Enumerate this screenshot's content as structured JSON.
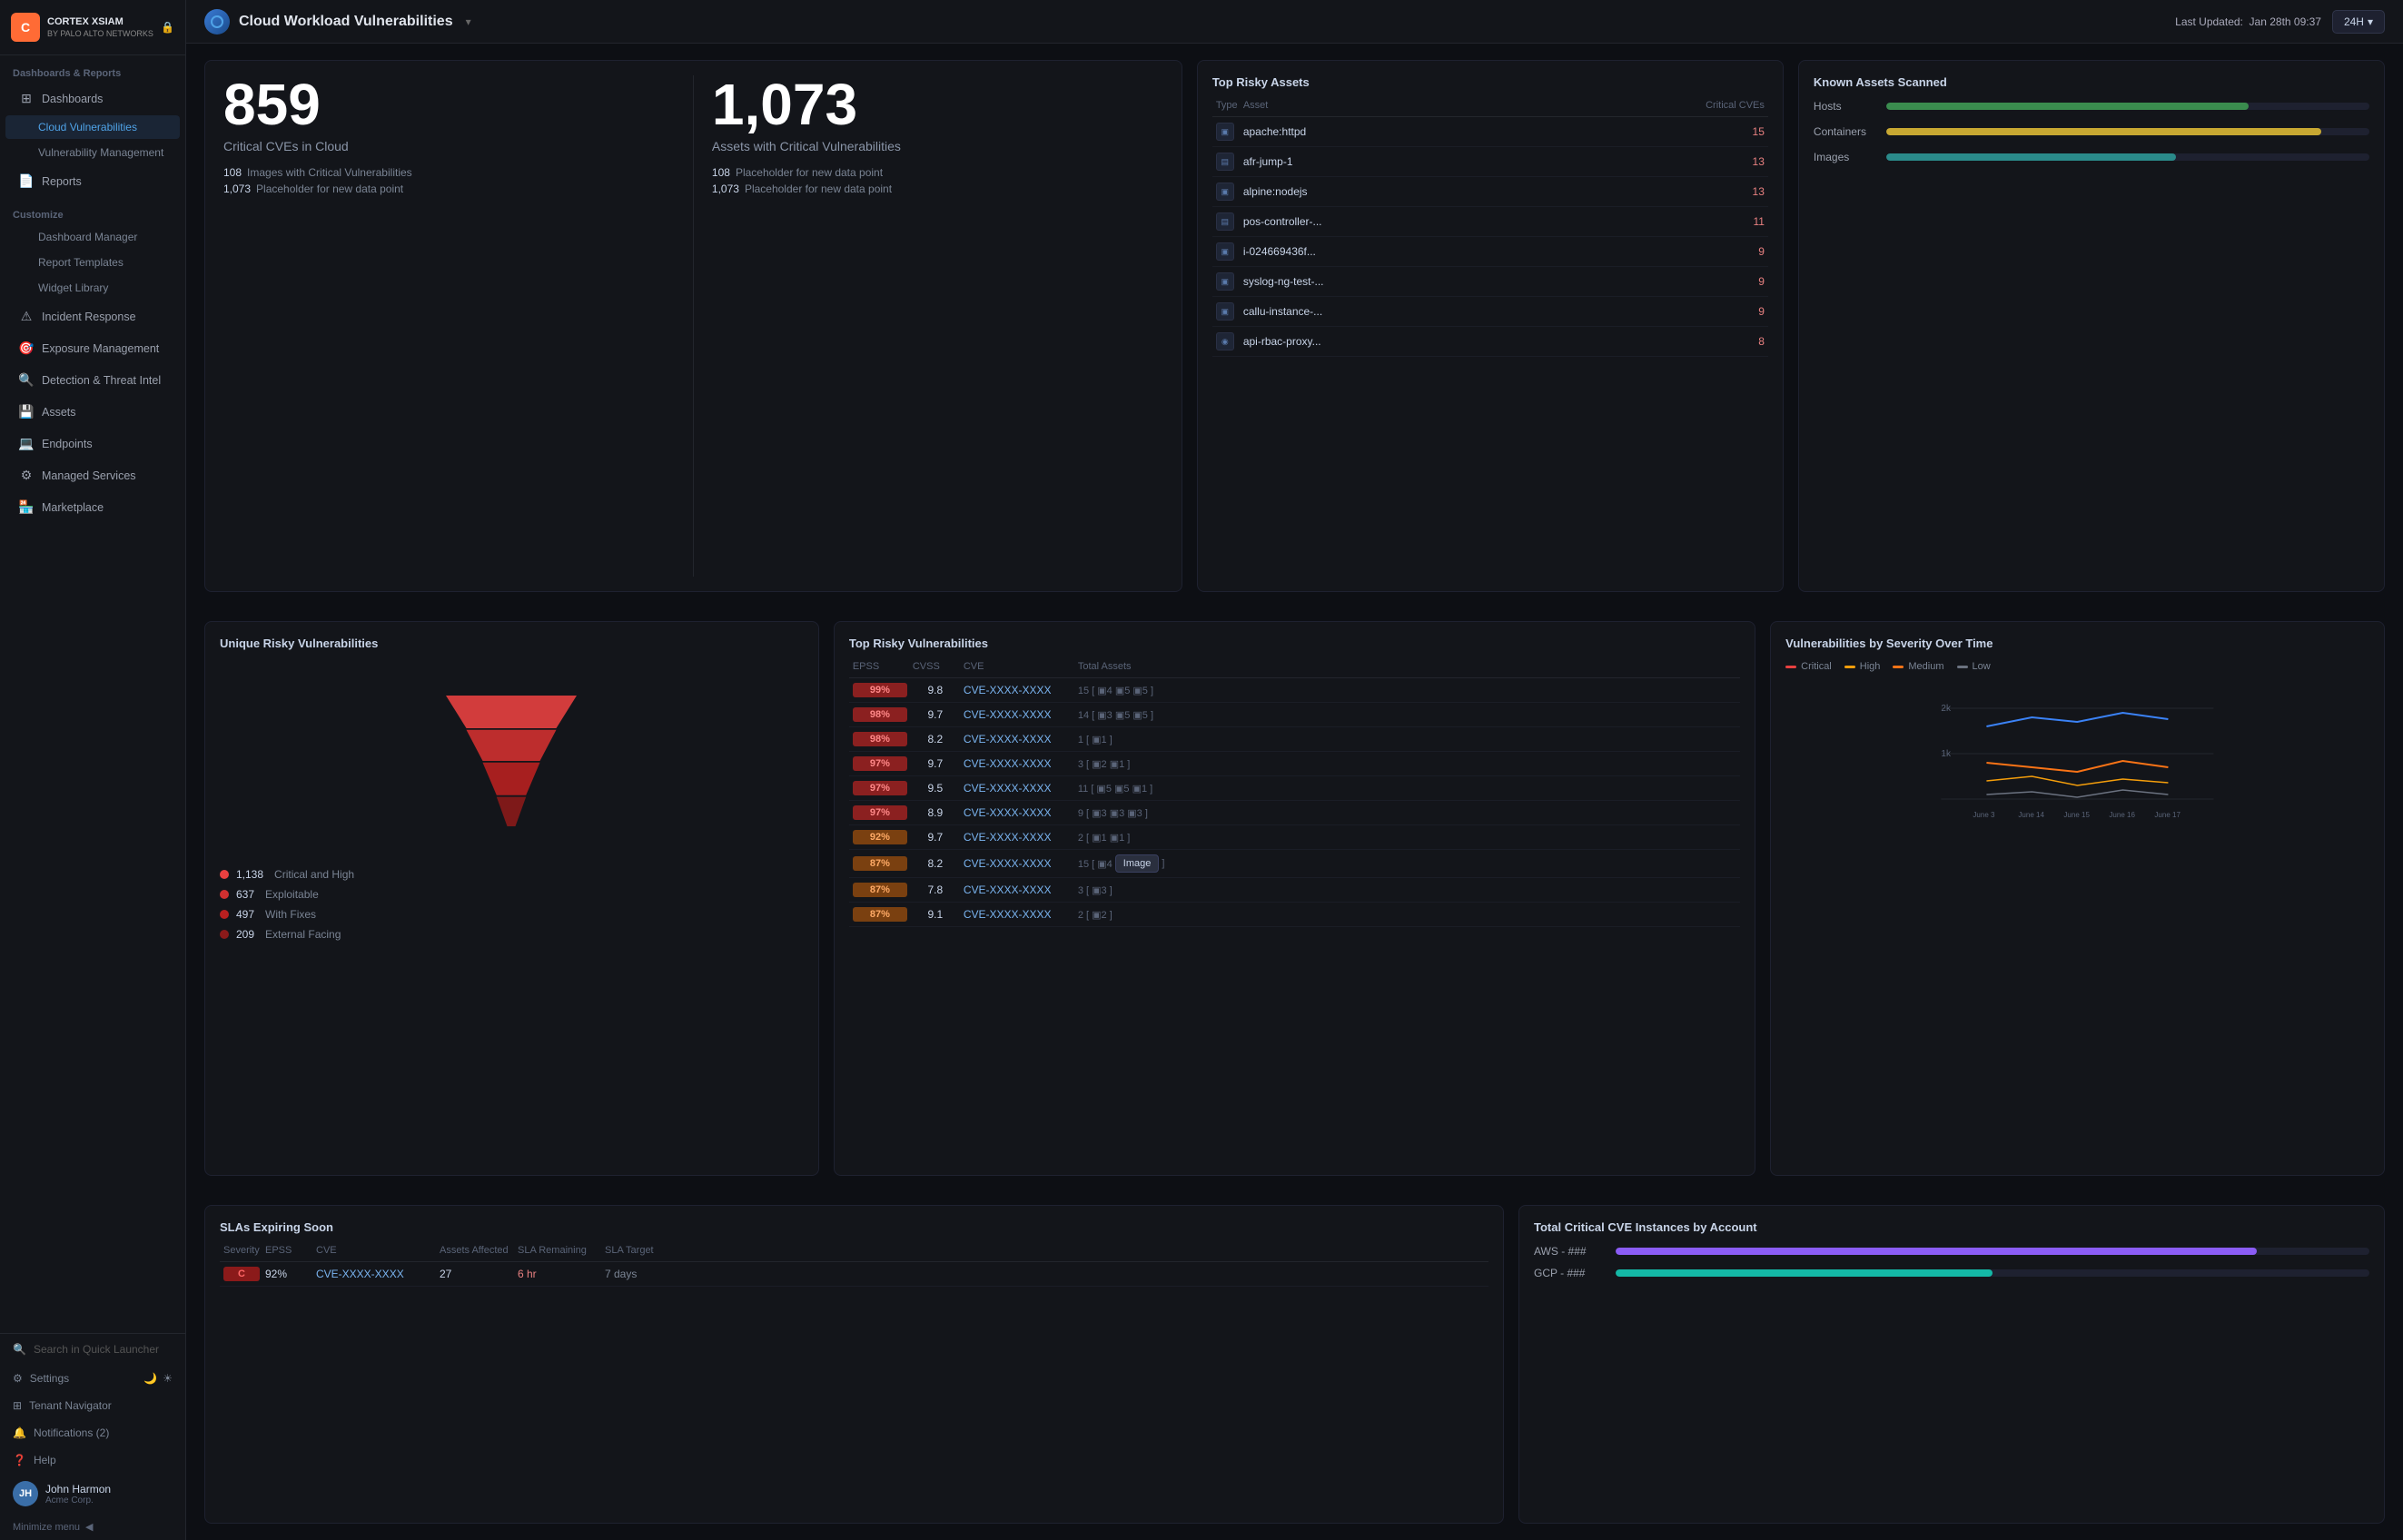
{
  "app": {
    "logo_letter": "C",
    "logo_name": "CORTEX XSIAM",
    "logo_sub": "BY PALO ALTO NETWORKS"
  },
  "topbar": {
    "page_title": "Cloud Workload Vulnerabilities",
    "last_updated_label": "Last Updated:",
    "last_updated_value": "Jan 28th 09:37",
    "time_filter": "24H"
  },
  "sidebar": {
    "sections": [
      {
        "label": "Dashboards & Reports",
        "items": [
          {
            "label": "Dashboards",
            "sub": false,
            "icon": "📊",
            "active": false
          },
          {
            "label": "Cloud Vulnerabilities",
            "sub": true,
            "active": true
          },
          {
            "label": "Vulnerability Management",
            "sub": true,
            "active": false
          }
        ]
      },
      {
        "label": "Reports",
        "items": []
      },
      {
        "label": "Customize",
        "items": [
          {
            "label": "Dashboard Manager",
            "sub": true,
            "active": false
          },
          {
            "label": "Report Templates",
            "sub": true,
            "active": false
          },
          {
            "label": "Widget Library",
            "sub": true,
            "active": false
          }
        ]
      }
    ],
    "nav_items": [
      {
        "id": "incident-response",
        "label": "Incident Response",
        "icon": "🔔"
      },
      {
        "id": "exposure-management",
        "label": "Exposure Management",
        "icon": "🛡️"
      },
      {
        "id": "detection-threat-intel",
        "label": "Detection & Threat Intel",
        "icon": "🔍"
      },
      {
        "id": "assets",
        "label": "Assets",
        "icon": "💾"
      },
      {
        "id": "endpoints",
        "label": "Endpoints",
        "icon": "💻"
      },
      {
        "id": "managed-services",
        "label": "Managed Services",
        "icon": "⚙️"
      },
      {
        "id": "marketplace",
        "label": "Marketplace",
        "icon": "🏪"
      }
    ],
    "search_placeholder": "Search in Quick Launcher",
    "footer_items": [
      {
        "label": "Settings",
        "icon": "⚙️"
      },
      {
        "label": "Tenant Navigator",
        "icon": "🏢"
      },
      {
        "label": "Notifications (2)",
        "icon": "🔔"
      },
      {
        "label": "Help",
        "icon": "❓"
      }
    ],
    "user": {
      "name": "John Harmon",
      "org": "Acme Corp.",
      "initials": "JH"
    },
    "minimize_label": "Minimize menu"
  },
  "stats": {
    "critical_cves": {
      "number": "859",
      "label": "Critical CVEs in Cloud",
      "sub_items": [
        {
          "num": "108",
          "text": "Images with Critical Vulnerabilities"
        },
        {
          "num": "1,073",
          "text": "Placeholder for new data point"
        }
      ]
    },
    "assets_critical": {
      "number": "1,073",
      "label": "Assets with Critical Vulnerabilities",
      "sub_items": [
        {
          "num": "108",
          "text": "Placeholder for new data point"
        },
        {
          "num": "1,073",
          "text": "Placeholder for new data point"
        }
      ]
    }
  },
  "risky_assets": {
    "title": "Top Risky Assets",
    "columns": [
      "Type",
      "Asset",
      "Critical CVEs"
    ],
    "rows": [
      {
        "type": "host",
        "name": "apache:httpd",
        "cves": "15"
      },
      {
        "type": "container",
        "name": "afr-jump-1",
        "cves": "13"
      },
      {
        "type": "host",
        "name": "alpine:nodejs",
        "cves": "13"
      },
      {
        "type": "container",
        "name": "pos-controller-...",
        "cves": "11"
      },
      {
        "type": "host",
        "name": "i-024669436f...",
        "cves": "9"
      },
      {
        "type": "host",
        "name": "syslog-ng-test-...",
        "cves": "9"
      },
      {
        "type": "host",
        "name": "callu-instance-...",
        "cves": "9"
      },
      {
        "type": "image",
        "name": "api-rbac-proxy...",
        "cves": "8"
      }
    ]
  },
  "known_assets": {
    "title": "Known Assets Scanned",
    "items": [
      {
        "label": "Hosts",
        "percent": 75,
        "color": "green"
      },
      {
        "label": "Containers",
        "percent": 90,
        "color": "yellow"
      },
      {
        "label": "Images",
        "percent": 60,
        "color": "teal"
      }
    ]
  },
  "unique_vulns": {
    "title": "Unique Risky Vulnerabilities",
    "legend": [
      {
        "num": "1,138",
        "label": "Critical and High",
        "color": "#e84040"
      },
      {
        "num": "637",
        "label": "Exploitable",
        "color": "#e05050"
      },
      {
        "num": "497",
        "label": "With Fixes",
        "color": "#c84040"
      },
      {
        "num": "209",
        "label": "External Facing",
        "color": "#8b2020"
      }
    ]
  },
  "top_vulns": {
    "title": "Top Risky Vulnerabilities",
    "columns": [
      "EPSS",
      "CVSS",
      "CVE",
      "Total Assets"
    ],
    "rows": [
      {
        "epss": "99%",
        "cvss": "9.8",
        "cve": "CVE-XXXX-XXXX",
        "assets": "15",
        "icons": "[ ▣4 ▣5 ▣5 ]",
        "color": "red"
      },
      {
        "epss": "98%",
        "cvss": "9.7",
        "cve": "CVE-XXXX-XXXX",
        "assets": "14",
        "icons": "[ ▣3 ▣5 ▣5 ]",
        "color": "red"
      },
      {
        "epss": "98%",
        "cvss": "8.2",
        "cve": "CVE-XXXX-XXXX",
        "assets": "1",
        "icons": "[ ▣1 ]",
        "color": "red"
      },
      {
        "epss": "97%",
        "cvss": "9.7",
        "cve": "CVE-XXXX-XXXX",
        "assets": "3",
        "icons": "[ ▣2 ▣1 ]",
        "color": "red"
      },
      {
        "epss": "97%",
        "cvss": "9.5",
        "cve": "CVE-XXXX-XXXX",
        "assets": "11",
        "icons": "[ ▣5 ▣5 ▣1 ]",
        "color": "red"
      },
      {
        "epss": "97%",
        "cvss": "8.9",
        "cve": "CVE-XXXX-XXXX",
        "assets": "9",
        "icons": "[ ▣3 ▣3 ▣3 ]",
        "color": "red"
      },
      {
        "epss": "92%",
        "cvss": "9.7",
        "cve": "CVE-XXXX-XXXX",
        "assets": "2",
        "icons": "[ ▣1 ▣1 ]",
        "color": "orange"
      },
      {
        "epss": "87%",
        "cvss": "8.2",
        "cve": "CVE-XXXX-XXXX",
        "assets": "15",
        "icons": "[ ▣4 Image ]",
        "color": "orange"
      },
      {
        "epss": "87%",
        "cvss": "7.8",
        "cve": "CVE-XXXX-XXXX",
        "assets": "3",
        "icons": "[ ▣3 ]",
        "color": "orange"
      },
      {
        "epss": "87%",
        "cvss": "9.1",
        "cve": "CVE-XXXX-XXXX",
        "assets": "2",
        "icons": "[ ▣2 ]",
        "color": "orange"
      }
    ],
    "tooltip": "Image"
  },
  "severity_chart": {
    "title": "Vulnerabilities by Severity Over Time",
    "legend": [
      {
        "label": "Critical",
        "color": "#e84040"
      },
      {
        "label": "High",
        "color": "#f59e0b"
      },
      {
        "label": "Medium",
        "color": "#f97316"
      },
      {
        "label": "Low",
        "color": "#6b7280"
      }
    ],
    "x_labels": [
      "June 3",
      "June 14",
      "June 15",
      "June 16",
      "June 17"
    ],
    "y_labels": [
      "2k",
      "1k"
    ]
  },
  "slas": {
    "title": "SLAs Expiring Soon",
    "columns": [
      "Severity",
      "EPSS",
      "CVE",
      "Assets Affected",
      "SLA Remaining",
      "SLA Target"
    ],
    "rows": [
      {
        "severity": "C",
        "epss": "92%",
        "cve": "CVE-XXXX-XXXX",
        "assets": "27",
        "sla_remaining": "6 hr",
        "sla_target": "7 days"
      }
    ]
  },
  "cve_by_account": {
    "title": "Total Critical CVE Instances by Account",
    "rows": [
      {
        "name": "AWS - ###",
        "percent": 85,
        "color": "purple"
      },
      {
        "name": "GCP - ###",
        "percent": 50,
        "color": "teal"
      }
    ]
  }
}
